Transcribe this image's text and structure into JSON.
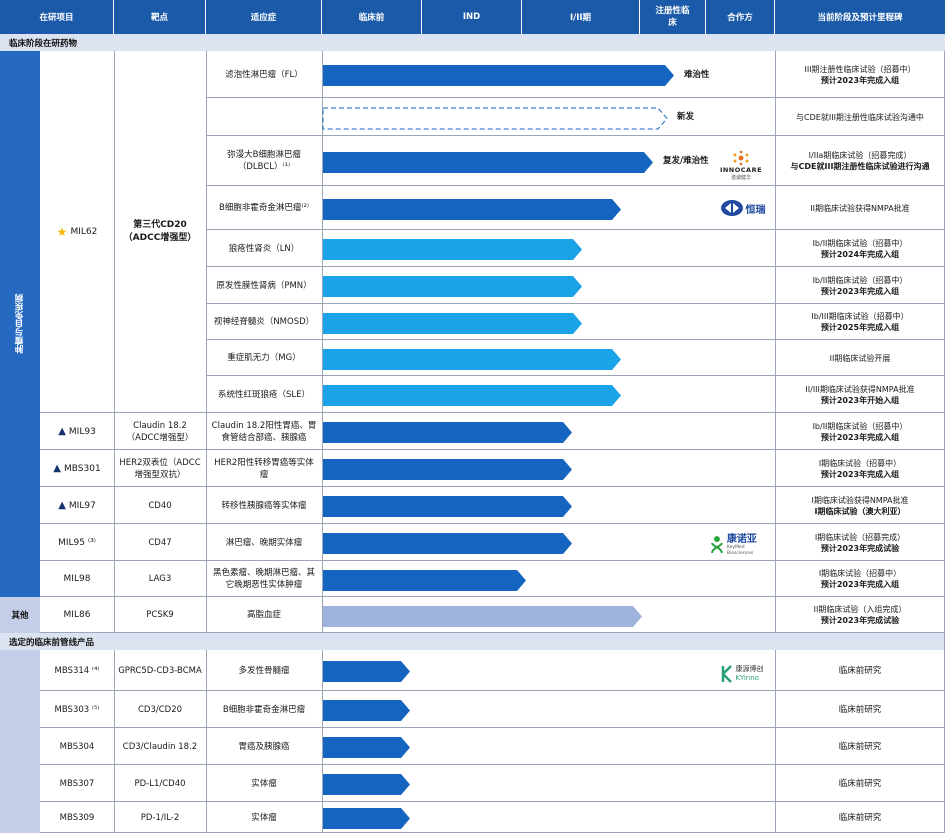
{
  "colors": {
    "header_bg": "#1b5aa8",
    "section_bg": "#dbe3f1",
    "bar_dark": "#1565c0",
    "bar_light": "#1aa3e8",
    "bar_pale": "#9fb4dc",
    "side_band": "#2569c0",
    "side_pale": "#c5cee8"
  },
  "header": {
    "project": "在研项目",
    "target": "靶点",
    "indication": "适应症",
    "preclinical": "临床前",
    "ind": "IND",
    "phase12": "I/II期",
    "registration": "注册性临床",
    "partner": "合作方",
    "milestone": "当前阶段及预计里程碑"
  },
  "sections": {
    "clinical": "临床阶段在研药物",
    "preclinical": "选定的临床前管线产品"
  },
  "side": {
    "oncology": "肿瘤与自免疾病",
    "other": "其他"
  },
  "drugs": [
    {
      "name": "MIL62",
      "marker": "★",
      "target": "第三代CD20（ADCC增强型）"
    },
    {
      "name": "MIL93",
      "marker": "▲",
      "target": "Claudin 18.2（ADCC增强型）"
    },
    {
      "name": "MBS301",
      "marker": "▲",
      "target": "HER2双表位（ADCC增强型双抗）"
    },
    {
      "name": "MIL97",
      "marker": "▲",
      "target": "CD40"
    },
    {
      "name": "MIL95 ⁽³⁾",
      "marker": "",
      "target": "CD47"
    },
    {
      "name": "MIL98",
      "marker": "",
      "target": "LAG3"
    },
    {
      "name": "MIL86",
      "marker": "",
      "target": "PCSK9"
    }
  ],
  "rows": [
    {
      "indication": "滤泡性淋巴瘤（FL）",
      "stage": 1.0,
      "style": "dark",
      "bar_label": "难治性",
      "milestone": [
        "III期注册性临床试验（招募中）",
        "预计2023年完成入组"
      ]
    },
    {
      "indication": "",
      "stage": 0.98,
      "style": "dashed",
      "bar_label": "新发",
      "milestone": [
        "与CDE就III期注册性临床试验沟通中"
      ]
    },
    {
      "indication": "弥漫大B细胞淋巴瘤（DLBCL）⁽¹⁾",
      "stage": 0.94,
      "style": "dark",
      "bar_label": "复发/难治性",
      "partner": "innocare",
      "milestone": [
        "I/IIa期临床试验（招募完成）",
        "与CDE就III期注册性临床试验进行沟通"
      ]
    },
    {
      "indication": "B细胞非霍奇金淋巴瘤⁽²⁾",
      "stage": 0.85,
      "style": "dark",
      "partner": "henglian",
      "milestone": [
        "II期临床试验获得NMPA批准"
      ]
    },
    {
      "indication": "狼疮性肾炎（LN）",
      "stage": 0.74,
      "style": "light",
      "milestone": [
        "Ib/II期临床试验（招募中）",
        "预计2024年完成入组"
      ]
    },
    {
      "indication": "原发性膜性肾病（PMN）",
      "stage": 0.74,
      "style": "light",
      "milestone": [
        "Ib/II期临床试验（招募中）",
        "预计2023年完成入组"
      ]
    },
    {
      "indication": "视神经脊髓炎（NMOSD）",
      "stage": 0.74,
      "style": "light",
      "milestone": [
        "Ib/III期临床试验（招募中）",
        "预计2025年完成入组"
      ]
    },
    {
      "indication": "重症肌无力（MG）",
      "stage": 0.85,
      "style": "light",
      "milestone": [
        "II期临床试验开展"
      ]
    },
    {
      "indication": "系统性红斑狼疮（SLE）",
      "stage": 0.85,
      "style": "light",
      "milestone": [
        "II/III期临床试验获得NMPA批准",
        "预计2023年开始入组"
      ]
    },
    {
      "indication": "Claudin 18.2阳性胃癌、胃食管结合部癌、胰腺癌",
      "stage": 0.71,
      "style": "dark",
      "milestone": [
        "Ib/II期临床试验（招募中）",
        "预计2023年完成入组"
      ]
    },
    {
      "indication": "HER2阳性转移胃癌等实体瘤",
      "stage": 0.71,
      "style": "dark",
      "milestone": [
        "I期临床试验（招募中）",
        "预计2023年完成入组"
      ]
    },
    {
      "indication": "转移性胰腺癌等实体瘤",
      "stage": 0.71,
      "style": "dark",
      "milestone": [
        "I期临床试验获得NMPA批准",
        "I期临床试验（澳大利亚）"
      ]
    },
    {
      "indication": "淋巴瘤、晚期实体瘤",
      "stage": 0.71,
      "style": "dark",
      "partner": "kangnuoya",
      "milestone": [
        "I期临床试验（招募完成）",
        "预计2023年完成试验"
      ]
    },
    {
      "indication": "黑色素瘤、晚期淋巴瘤、其它晚期恶性实体肿瘤",
      "stage": 0.58,
      "style": "dark",
      "milestone": [
        "I期临床试验（招募中）",
        "预计2023年完成入组"
      ]
    },
    {
      "indication": "高脂血症",
      "stage": 0.91,
      "style": "pale",
      "milestone": [
        "II期临床试验（入组完成）",
        "预计2023年完成试验"
      ]
    }
  ],
  "preclinical": [
    {
      "name": "MBS314 ⁽⁴⁾",
      "target": "GPRC5D-CD3-BCMA",
      "indication": "多发性骨髓瘤",
      "partner": "kyinno",
      "milestone": "临床前研究"
    },
    {
      "name": "MBS303 ⁽⁵⁾",
      "target": "CD3/CD20",
      "indication": "B细胞非霍奇金淋巴瘤",
      "milestone": "临床前研究"
    },
    {
      "name": "MBS304",
      "target": "CD3/Claudin 18.2",
      "indication": "胃癌及胰腺癌",
      "milestone": "临床前研究"
    },
    {
      "name": "MBS307",
      "target": "PD-L1/CD40",
      "indication": "实体瘤",
      "milestone": "临床前研究"
    },
    {
      "name": "MBS309",
      "target": "PD-1/IL-2",
      "indication": "实体瘤",
      "milestone": "临床前研究"
    }
  ],
  "partners": {
    "innocare": {
      "name": "INNOCARE",
      "sub": "诺诚健华",
      "icon": "innocare-icon"
    },
    "henglian": {
      "name": "恒瑞",
      "icon": "hengrui-icon"
    },
    "kangnuoya": {
      "name": "康诺亚",
      "sub": "KeyMed Biosciences",
      "icon": "keymed-icon"
    },
    "kyinno": {
      "name": "康源博创",
      "sub": "KYinno",
      "icon": "kyinno-icon"
    }
  }
}
